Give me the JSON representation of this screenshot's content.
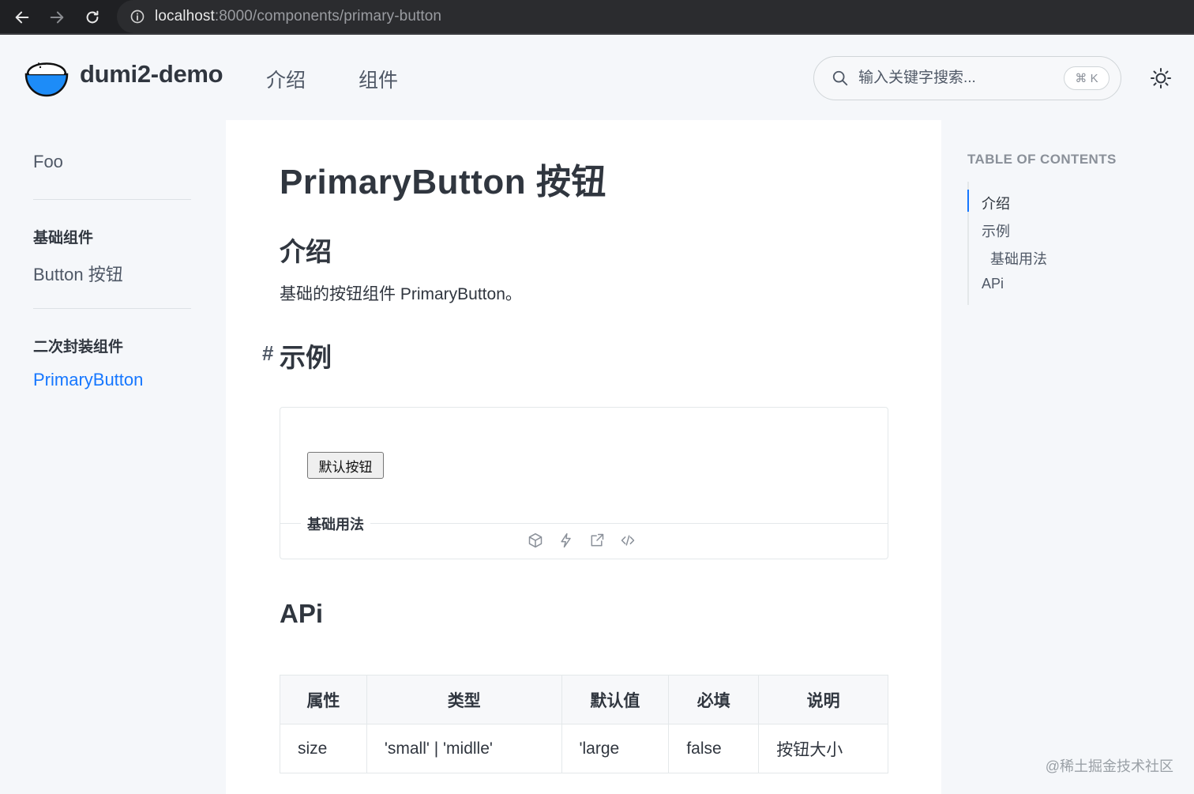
{
  "browser": {
    "url_host": "localhost",
    "url_path": ":8000/components/primary-button"
  },
  "header": {
    "brand": "dumi2-demo",
    "nav": [
      "介绍",
      "组件"
    ],
    "search_placeholder": "输入关键字搜索...",
    "search_shortcut": "⌘ K"
  },
  "sidebar": {
    "top_link": "Foo",
    "groups": [
      {
        "title": "基础组件",
        "items": [
          "Button 按钮"
        ]
      },
      {
        "title": "二次封装组件",
        "items": [
          "PrimaryButton"
        ]
      }
    ],
    "active_item": "PrimaryButton"
  },
  "main": {
    "title": "PrimaryButton 按钮",
    "intro_heading": "介绍",
    "intro_text": "基础的按钮组件 PrimaryButton。",
    "example_anchor": "#",
    "example_heading": "示例",
    "demo": {
      "button_label": "默认按钮",
      "caption": "基础用法",
      "actions": [
        "codesandbox-icon",
        "stackblitz-icon",
        "open-external-icon",
        "code-icon"
      ]
    },
    "api_heading": "APi",
    "api_table": {
      "headers": [
        "属性",
        "类型",
        "默认值",
        "必填",
        "说明"
      ],
      "rows": [
        [
          "size",
          "'small' | 'midlle'",
          "'large",
          "false",
          "按钮大小"
        ]
      ]
    }
  },
  "toc": {
    "title": "TABLE OF CONTENTS",
    "items": [
      "介绍",
      "示例",
      "基础用法",
      "APi"
    ],
    "active_item": "介绍"
  },
  "watermark": "@稀土掘金技术社区",
  "colors": {
    "accent": "#1677ff",
    "text": "#30363f",
    "chrome": "#1f2023",
    "page_bg": "#f5f7fa"
  }
}
